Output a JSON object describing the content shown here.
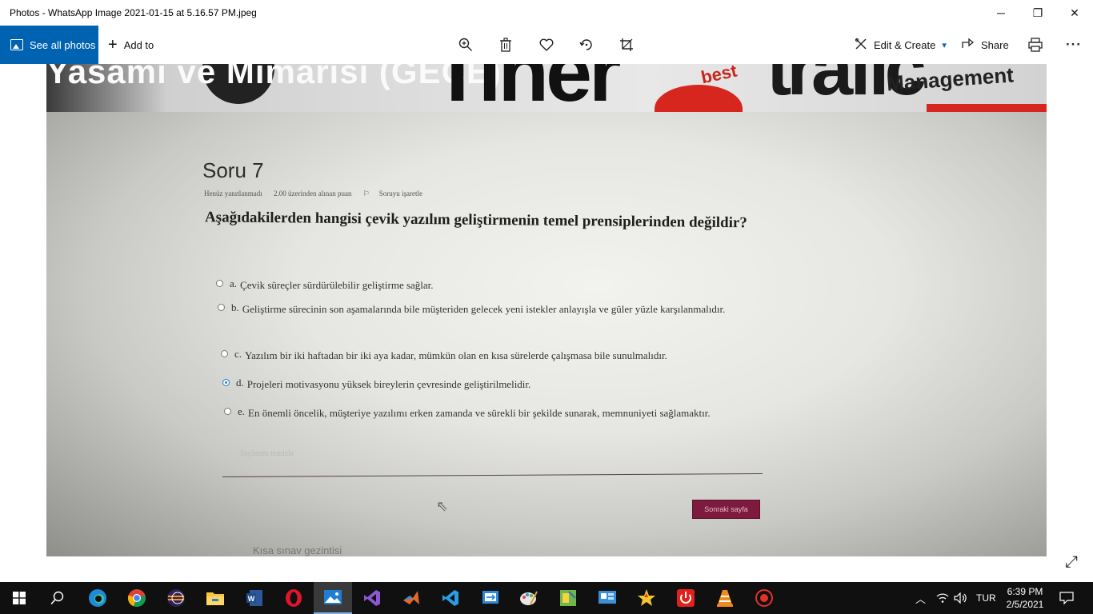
{
  "window": {
    "title": "Photos - WhatsApp Image 2021-01-15 at 5.16.57 PM.jpeg",
    "minimize_glyph": "─",
    "restore_glyph": "❐",
    "close_glyph": "✕"
  },
  "toolbar": {
    "see_all_label": "See all photos",
    "add_to_label": "Add to",
    "edit_create_label": "Edit & Create",
    "share_label": "Share",
    "more_glyph": "···"
  },
  "icons": {
    "zoom": "zoom-in-icon",
    "delete": "trash-icon",
    "favorite": "heart-icon",
    "rotate": "rotate-icon",
    "crop": "crop-icon",
    "print": "print-icon"
  },
  "photo": {
    "banner_text_left": "Yasamı ve Mimarisi (GECE)",
    "banner_text_big": "Tiner",
    "banner_text_right": "trafic",
    "banner_small_1": "best",
    "banner_small_2": "Management",
    "question_number": "Soru 7",
    "status": "Henüz yanıtlanmadı",
    "points": "2.00 üzerinden alınan puan",
    "flag": "Soruyu işaretle",
    "question": "Aşağıdakilerden hangisi çevik yazılım geliştirmenin temel prensiplerinden değildir?",
    "options": [
      {
        "letter": "a.",
        "text": "Çevik süreçler sürdürülebilir geliştirme sağlar.",
        "selected": false
      },
      {
        "letter": "b.",
        "text": "Geliştirme sürecinin son aşamalarında bile müşteriden gelecek yeni istekler anlayışla ve güler yüzle karşılanmalıdır.",
        "selected": false
      },
      {
        "letter": "c.",
        "text": "Yazılım bir iki haftadan bir iki aya kadar, mümkün olan en kısa sürelerde çalışmasa bile sunulmalıdır.",
        "selected": false
      },
      {
        "letter": "d.",
        "text": "Projeleri motivasyonu yüksek bireylerin çevresinde geliştirilmelidir.",
        "selected": true
      },
      {
        "letter": "e.",
        "text": "En önemli öncelik, müşteriye yazılımı erken zamanda ve sürekli bir şekilde sunarak, memnuniyeti sağlamaktır.",
        "selected": false
      }
    ],
    "clear_choice": "Seçimim temizle",
    "next_button": "Sonraki sayfa",
    "quiz_nav": "Kısa sınav gezintisi"
  },
  "taskbar": {
    "apps": [
      "start",
      "search",
      "edge",
      "chrome",
      "eclipse",
      "file-explorer",
      "word",
      "opera",
      "photos",
      "visual-studio",
      "matlab",
      "vscode",
      "teamviewer",
      "paint",
      "app-green",
      "app-blue",
      "app-star",
      "power",
      "vlc",
      "recorder"
    ],
    "language": "TUR",
    "time": "6:39 PM",
    "date": "2/5/2021"
  },
  "colors": {
    "accent": "#0063b1",
    "next_button": "#7d1b3e",
    "radio_selected": "#2b7fd4",
    "taskbar": "#101010"
  }
}
